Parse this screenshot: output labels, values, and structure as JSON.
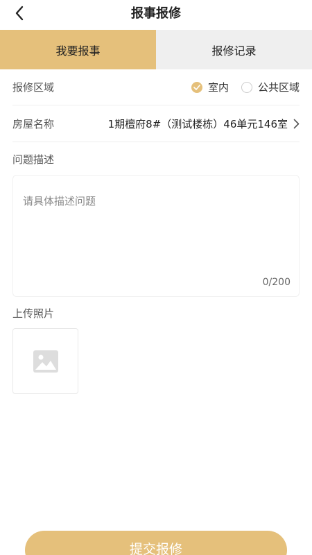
{
  "header": {
    "title": "报事报修",
    "back_icon": "chevron-left-icon"
  },
  "tabs": [
    {
      "label": "我要报事",
      "active": true
    },
    {
      "label": "报修记录",
      "active": false
    }
  ],
  "repair_area": {
    "label": "报修区域",
    "options": [
      {
        "label": "室内",
        "checked": true
      },
      {
        "label": "公共区域",
        "checked": false
      }
    ]
  },
  "house": {
    "label": "房屋名称",
    "value": "1期檀府8#（测试楼栋）46单元146室"
  },
  "description": {
    "label": "问题描述",
    "placeholder": "请具体描述问题",
    "value": "",
    "counter": "0/200"
  },
  "photos": {
    "label": "上传照片",
    "icon": "image-placeholder-icon"
  },
  "submit": {
    "label": "提交报修"
  },
  "colors": {
    "accent": "#e5c07b",
    "tab_inactive": "#efefef",
    "text": "#333333"
  }
}
